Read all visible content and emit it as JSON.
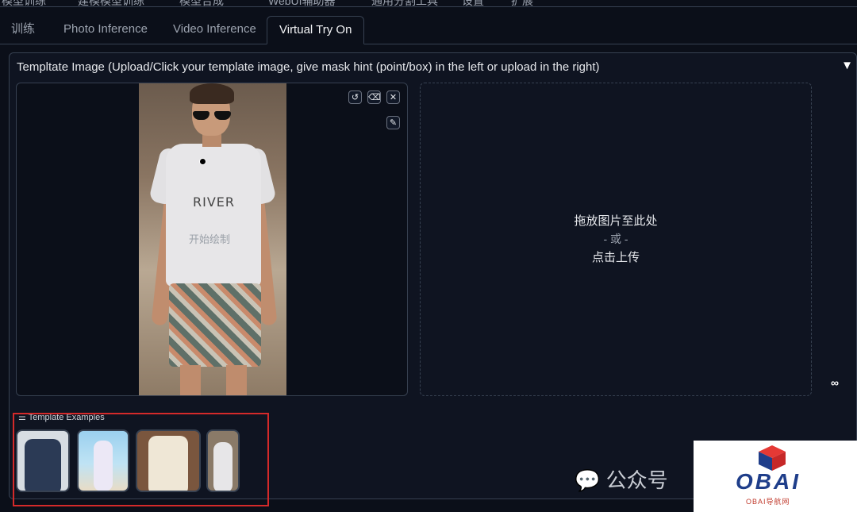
{
  "top_nav": {
    "items": [
      "模型训练",
      "建模模型训练",
      "模型合成",
      "WebUI辅助器",
      "通用分割工具",
      "设置",
      "扩展"
    ]
  },
  "tabs": [
    "训练",
    "Photo Inference",
    "Video Inference",
    "Virtual Try On"
  ],
  "active_tab": "Virtual Try On",
  "panel": {
    "title": "Templtate Image (Upload/Click your template image, give mask hint (point/box) in the left or upload in the right)",
    "collapse_icon": "▼"
  },
  "editor": {
    "hint": "开始绘制",
    "shirt_print": "RIVER",
    "tools": [
      "undo-icon",
      "erase-icon",
      "close-icon",
      "brush-icon"
    ]
  },
  "dropzone": {
    "line1": "拖放图片至此处",
    "line2": "- 或 -",
    "line3": "点击上传"
  },
  "examples": {
    "label": "Template Examples",
    "items": [
      "example-1",
      "example-2",
      "example-3",
      "example-4"
    ]
  },
  "watermark": {
    "text": "公众号"
  },
  "logo": {
    "text": "OBAI",
    "sub": "OBAI导航网"
  },
  "colors": {
    "background": "#0b0f19",
    "border": "#374151",
    "highlight": "#d42a2a",
    "logo_blue": "#1f3e8a",
    "logo_red": "#c0392b"
  }
}
